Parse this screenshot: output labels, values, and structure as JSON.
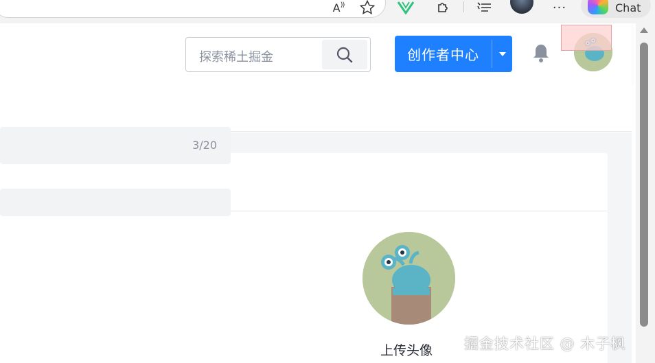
{
  "browser": {
    "read_aloud_label": "A",
    "copilot_label": "Chat",
    "more_label": "···"
  },
  "header": {
    "search_placeholder": "探索稀土掘金",
    "creator_button_label": "创作者中心"
  },
  "profile_form": {
    "name_counter": "3/20",
    "upload_avatar_label": "上传头像"
  },
  "watermark": "掘金技术社区 @ 木子枫",
  "colors": {
    "accent": "#1e80ff",
    "page_bg": "#f4f5f7",
    "avatar_bg": "#b8c89a"
  },
  "icons": {
    "search": "search-icon",
    "bell": "bell-icon",
    "dropdown": "caret-down-icon",
    "favorite": "star-icon",
    "extensions": "puzzle-icon",
    "collections": "collections-icon"
  }
}
